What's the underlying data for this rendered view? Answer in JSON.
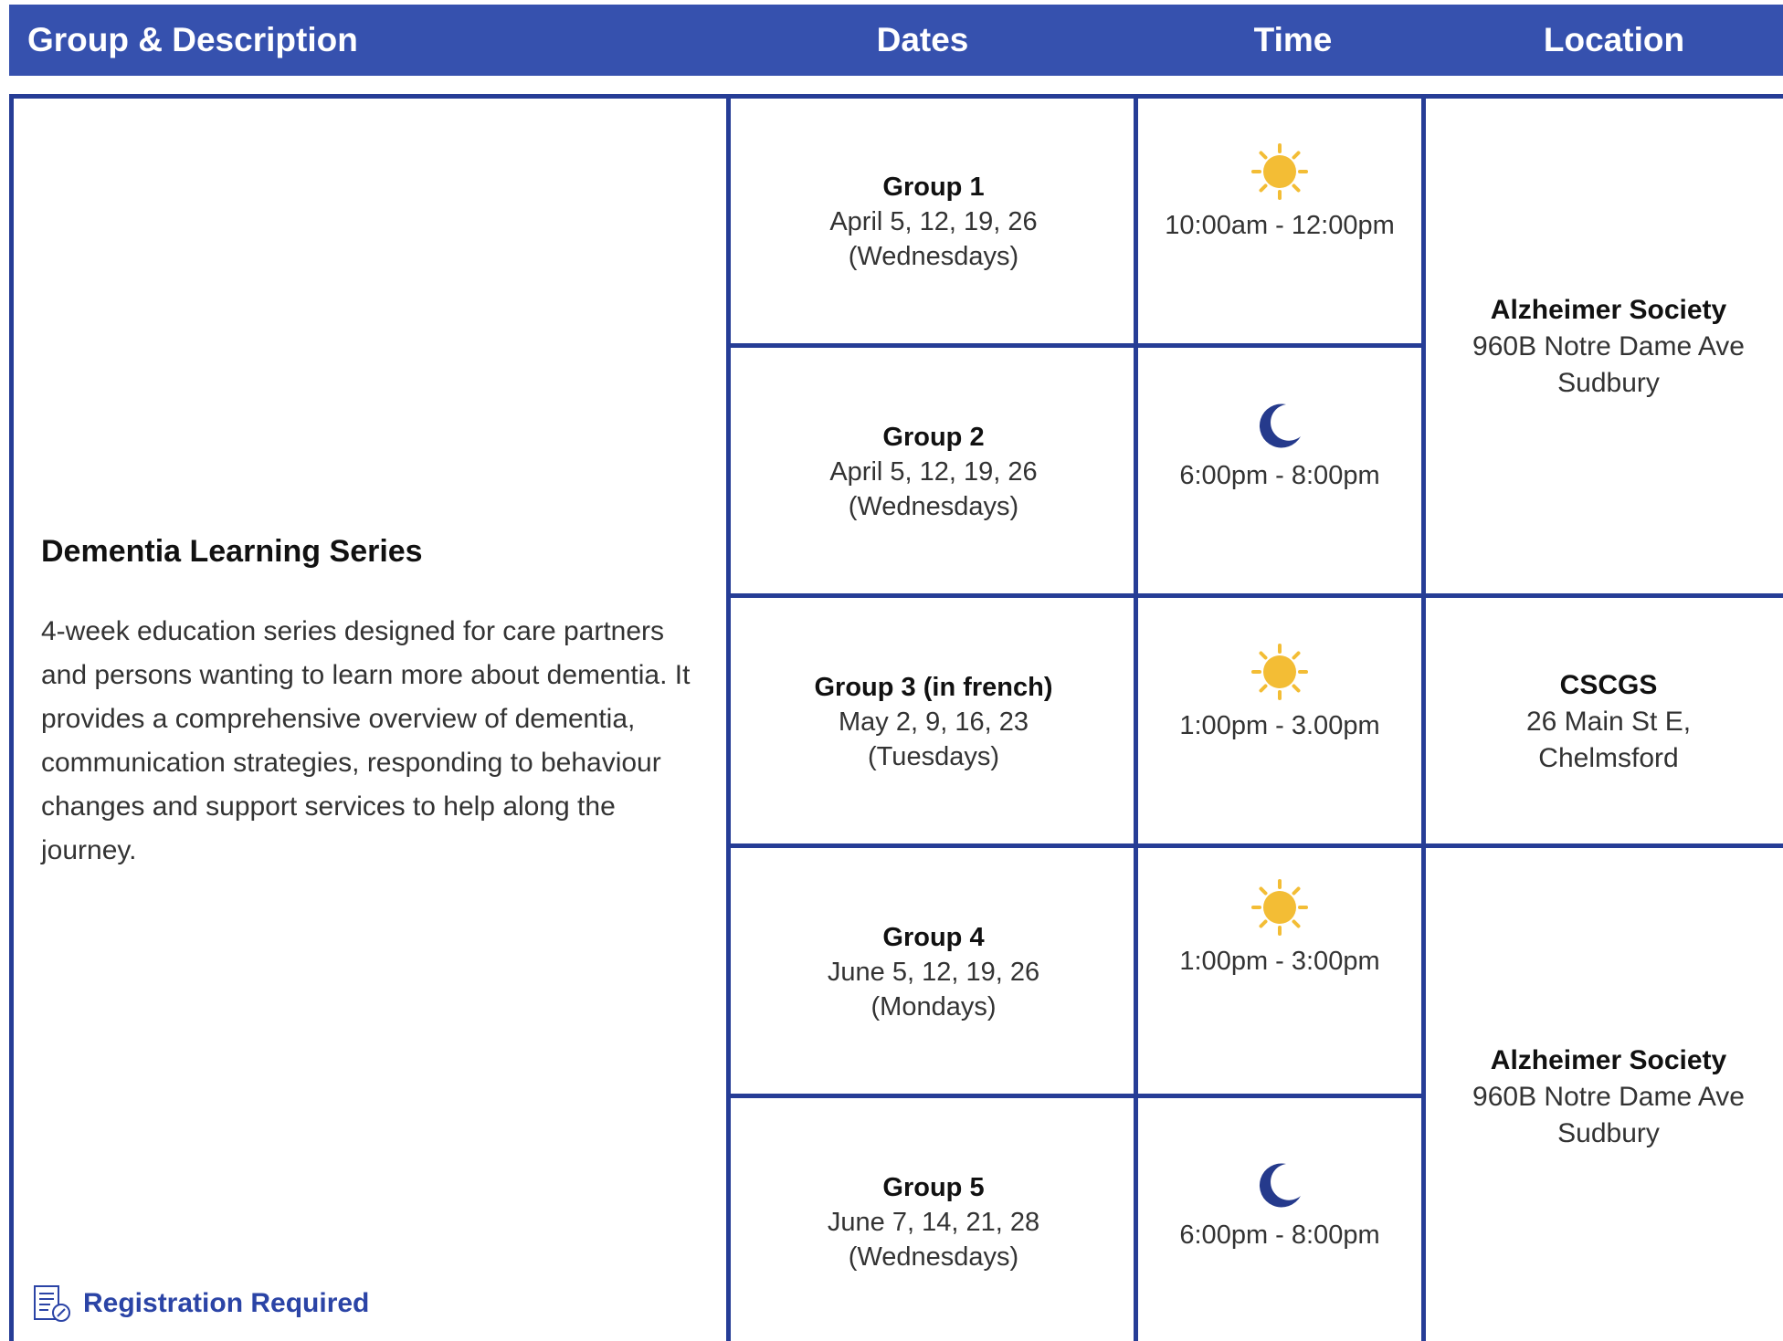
{
  "header": {
    "group_description": "Group & Description",
    "dates": "Dates",
    "time": "Time",
    "location": "Location"
  },
  "program": {
    "title": "Dementia Learning Series",
    "description": "4-week education series designed for care partners and persons wanting to learn more about dementia. It provides a comprehensive overview of dementia, communication strategies, responding to behaviour changes and support services to help along the journey.",
    "registration": "Registration Required"
  },
  "groups": [
    {
      "name": "Group 1",
      "dates": "April 5, 12, 19, 26",
      "days": "(Wednesdays)",
      "time": "10:00am - 12:00pm",
      "time_icon": "sun-icon"
    },
    {
      "name": "Group 2",
      "dates": "April 5, 12, 19, 26",
      "days": "(Wednesdays)",
      "time": "6:00pm - 8:00pm",
      "time_icon": "moon-icon"
    },
    {
      "name": "Group 3 (in french)",
      "dates": "May 2, 9, 16, 23",
      "days": "(Tuesdays)",
      "time": "1:00pm - 3.00pm",
      "time_icon": "sun-icon"
    },
    {
      "name": "Group 4",
      "dates": "June 5, 12, 19, 26",
      "days": "(Mondays)",
      "time": "1:00pm - 3:00pm",
      "time_icon": "sun-icon"
    },
    {
      "name": "Group 5",
      "dates": "June 7, 14, 21, 28",
      "days": "(Wednesdays)",
      "time": "6:00pm - 8:00pm",
      "time_icon": "moon-icon"
    }
  ],
  "locations": [
    {
      "name": "Alzheimer Society",
      "line1": "960B Notre Dame Ave",
      "line2": "Sudbury"
    },
    {
      "name": "CSCGS",
      "line1": "26 Main St E,",
      "line2": "Chelmsford"
    },
    {
      "name": "Alzheimer Society",
      "line1": "960B Notre Dame Ave",
      "line2": "Sudbury"
    }
  ],
  "colors": {
    "header_bg": "#3651ae",
    "border": "#263d96",
    "sun": "#f3bd35",
    "moon": "#253a8c",
    "link": "#2b44a6"
  }
}
